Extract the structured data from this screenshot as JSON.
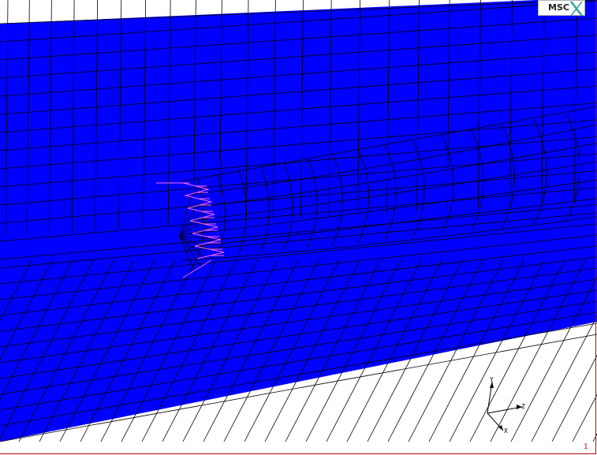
{
  "logo": {
    "text": "MSC"
  },
  "triad": {
    "y_label": "Y",
    "z_label": "Z",
    "x_label": "X"
  },
  "viewport": {
    "number": "1"
  },
  "colors": {
    "mesh_fill": "#0000ff",
    "mesh_lines": "#000000",
    "load_arrows": "#ff66ff",
    "viewport_border": "#c00000"
  }
}
